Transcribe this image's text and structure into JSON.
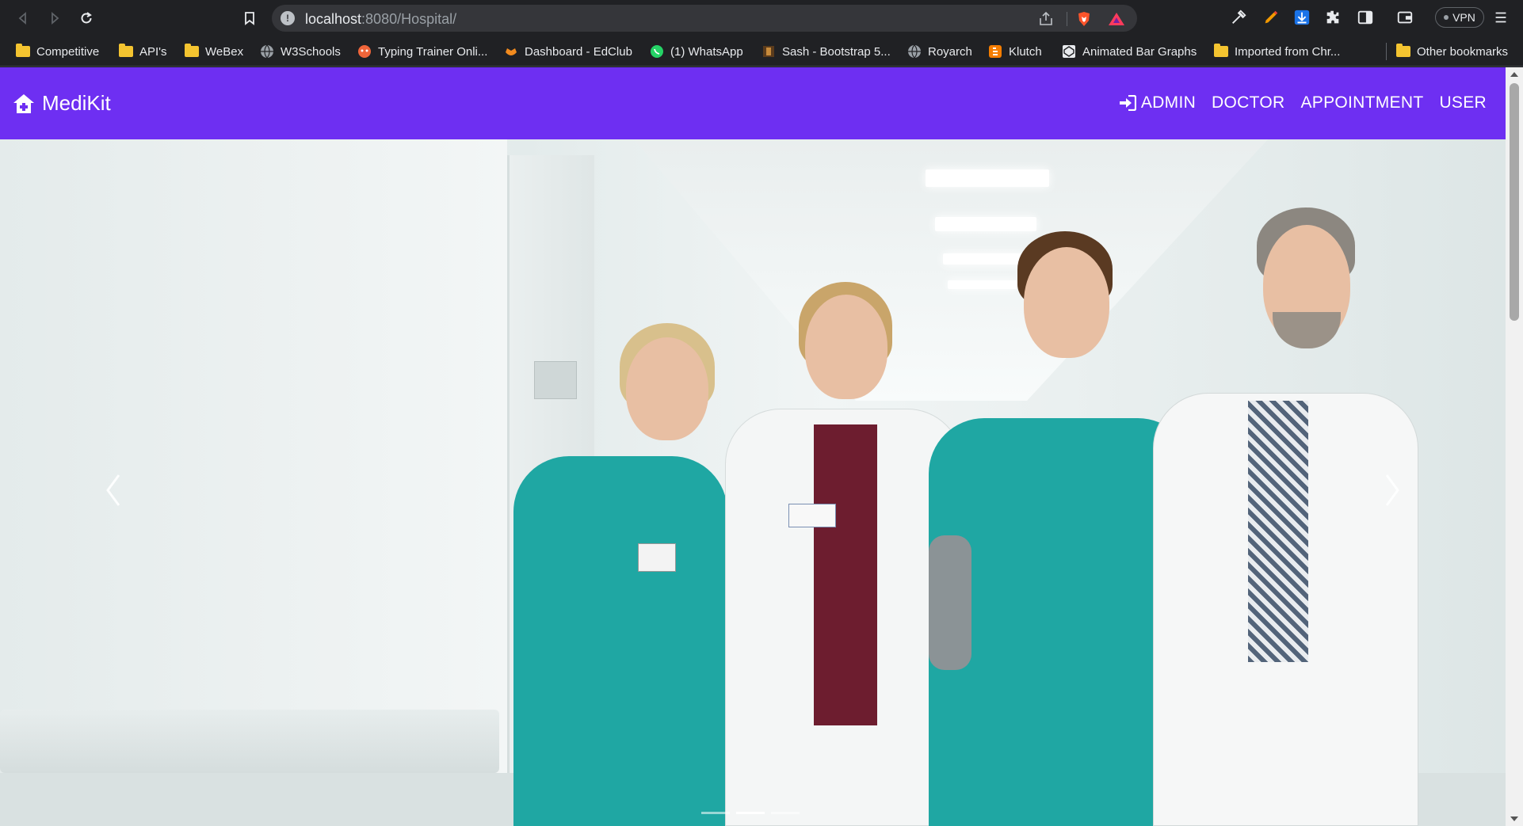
{
  "browser": {
    "url_host": "localhost",
    "url_path": ":8080/Hospital/",
    "vpn_label": "VPN",
    "bookmarks": [
      {
        "label": "Competitive",
        "icon": "folder-icon"
      },
      {
        "label": "API's",
        "icon": "folder-icon"
      },
      {
        "label": "WeBex",
        "icon": "folder-icon"
      },
      {
        "label": "W3Schools",
        "icon": "globe-icon"
      },
      {
        "label": "Typing Trainer Onli...",
        "icon": "typing-trainer-icon"
      },
      {
        "label": "Dashboard - EdClub",
        "icon": "edclub-icon"
      },
      {
        "label": "(1) WhatsApp",
        "icon": "whatsapp-icon"
      },
      {
        "label": "Sash - Bootstrap 5...",
        "icon": "sash-icon"
      },
      {
        "label": "Royarch",
        "icon": "globe-icon"
      },
      {
        "label": "Klutch",
        "icon": "blogger-icon"
      },
      {
        "label": "Animated Bar Graphs",
        "icon": "codepen-icon"
      },
      {
        "label": "Imported from Chr...",
        "icon": "folder-icon"
      }
    ],
    "other_bookmarks": "Other bookmarks"
  },
  "site": {
    "brand": "MediKit",
    "nav": [
      {
        "label": "ADMIN",
        "icon": "login-icon"
      },
      {
        "label": "DOCTOR"
      },
      {
        "label": "APPOINTMENT"
      },
      {
        "label": "USER"
      }
    ]
  },
  "carousel": {
    "slide_count": 3,
    "active_index": 1
  },
  "colors": {
    "navbar": "#6e2ff2",
    "chrome": "#202124",
    "scrub_teal": "#1fa7a3"
  }
}
